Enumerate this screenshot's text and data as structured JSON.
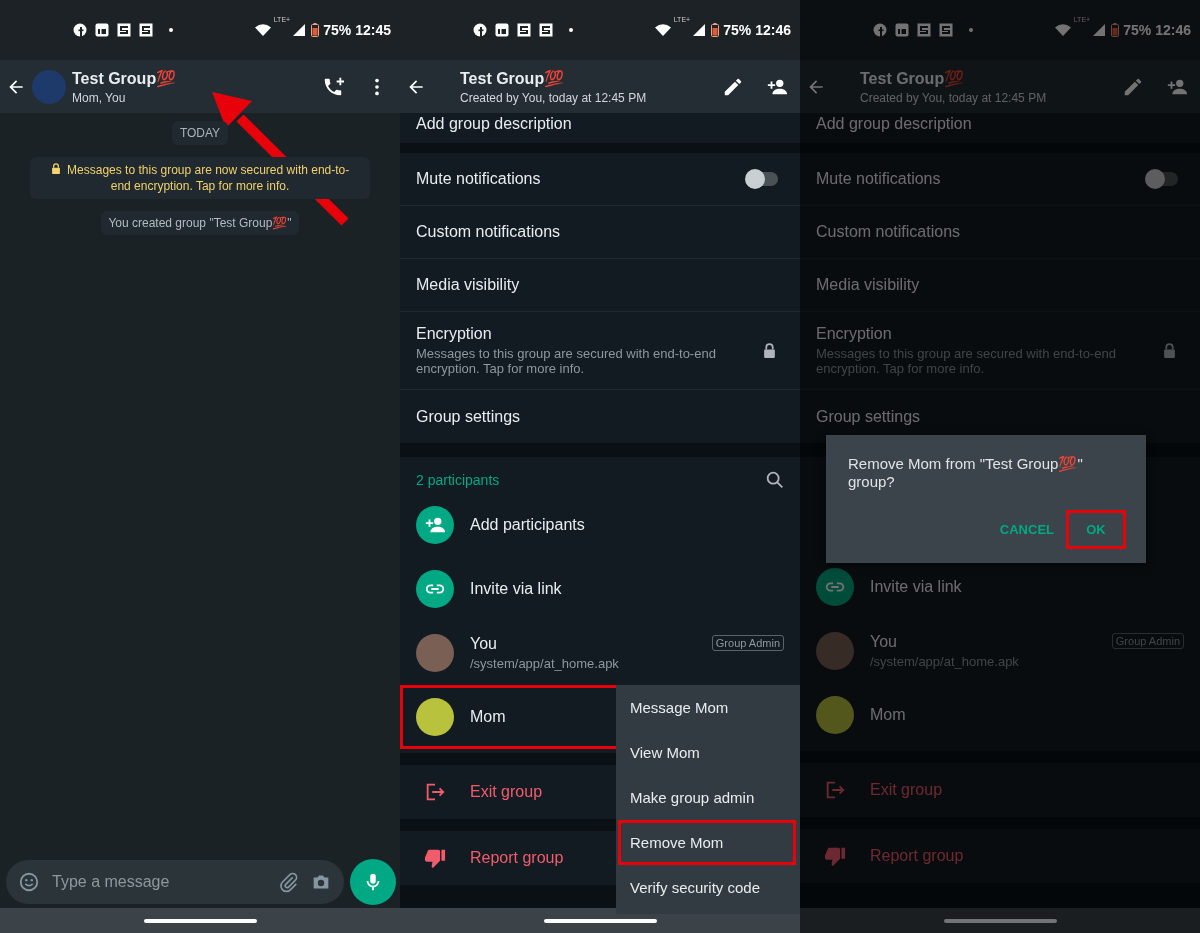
{
  "screens": [
    {
      "kind": "chat",
      "dimmed": false,
      "status_bar": {
        "network": "LTE+",
        "battery": "75%",
        "time": "12:45"
      },
      "header": {
        "title": "Test Group💯",
        "subtitle": "Mom, You"
      },
      "arrow_annotation": true,
      "date_chip": "TODAY",
      "system_messages": [
        {
          "kind": "encryption",
          "text": "Messages to this group are now secured with end-to-end encryption. Tap for more info."
        },
        {
          "kind": "plain",
          "text": "You created group \"Test Group💯\""
        }
      ],
      "composer": {
        "placeholder": "Type a message"
      }
    },
    {
      "kind": "info",
      "dimmed": false,
      "status_bar": {
        "network": "LTE+",
        "battery": "75%",
        "time": "12:46"
      },
      "header": {
        "title": "Test Group💯",
        "subtitle": "Created by You, today at 12:45 PM"
      },
      "description": "Add group description",
      "settings": [
        {
          "kind": "toggle",
          "label": "Mute notifications",
          "on": false
        },
        {
          "kind": "plain",
          "label": "Custom notifications"
        },
        {
          "kind": "plain",
          "label": "Media visibility"
        },
        {
          "kind": "lock",
          "label": "Encryption",
          "subtitle": "Messages to this group are secured with end-to-end encryption. Tap for more info."
        },
        {
          "kind": "plain",
          "label": "Group settings"
        }
      ],
      "participants_header": "2 participants",
      "participant_actions": [
        {
          "kind": "add",
          "label": "Add participants"
        },
        {
          "kind": "link",
          "label": "Invite via link"
        }
      ],
      "participants": [
        {
          "name": "You",
          "about": "/system/app/at_home.apk",
          "badge": "Group Admin",
          "highlighted": false
        },
        {
          "name": "Mom",
          "highlighted": true
        }
      ],
      "group_actions": [
        {
          "kind": "exit",
          "label": "Exit group"
        },
        {
          "kind": "report",
          "label": "Report group"
        }
      ],
      "context_menu": [
        {
          "label": "Message Mom",
          "highlighted": false
        },
        {
          "label": "View Mom",
          "highlighted": false
        },
        {
          "label": "Make group admin",
          "highlighted": false
        },
        {
          "label": "Remove Mom",
          "highlighted": true
        },
        {
          "label": "Verify security code",
          "highlighted": false
        }
      ]
    },
    {
      "kind": "info",
      "dimmed": true,
      "status_bar": {
        "network": "LTE+",
        "battery": "75%",
        "time": "12:46"
      },
      "header": {
        "title": "Test Group💯",
        "subtitle": "Created by You, today at 12:45 PM"
      },
      "description": "Add group description",
      "settings": [
        {
          "kind": "toggle",
          "label": "Mute notifications",
          "on": false
        },
        {
          "kind": "plain",
          "label": "Custom notifications"
        },
        {
          "kind": "plain",
          "label": "Media visibility"
        },
        {
          "kind": "lock",
          "label": "Encryption",
          "subtitle": "Messages to this group are secured with end-to-end encryption. Tap for more info."
        },
        {
          "kind": "plain",
          "label": "Group settings"
        }
      ],
      "participant_actions": [
        {
          "kind": "link",
          "label": "Invite via link"
        }
      ],
      "participants": [
        {
          "name": "You",
          "about": "/system/app/at_home.apk",
          "badge": "Group Admin",
          "highlighted": false
        },
        {
          "name": "Mom",
          "highlighted": false
        }
      ],
      "group_actions": [
        {
          "kind": "exit",
          "label": "Exit group"
        },
        {
          "kind": "report",
          "label": "Report group"
        }
      ],
      "dialog": {
        "message": "Remove Mom from \"Test Group💯\" group?",
        "buttons": [
          {
            "label": "CANCEL",
            "highlighted": false
          },
          {
            "label": "OK",
            "highlighted": true
          }
        ]
      }
    }
  ]
}
